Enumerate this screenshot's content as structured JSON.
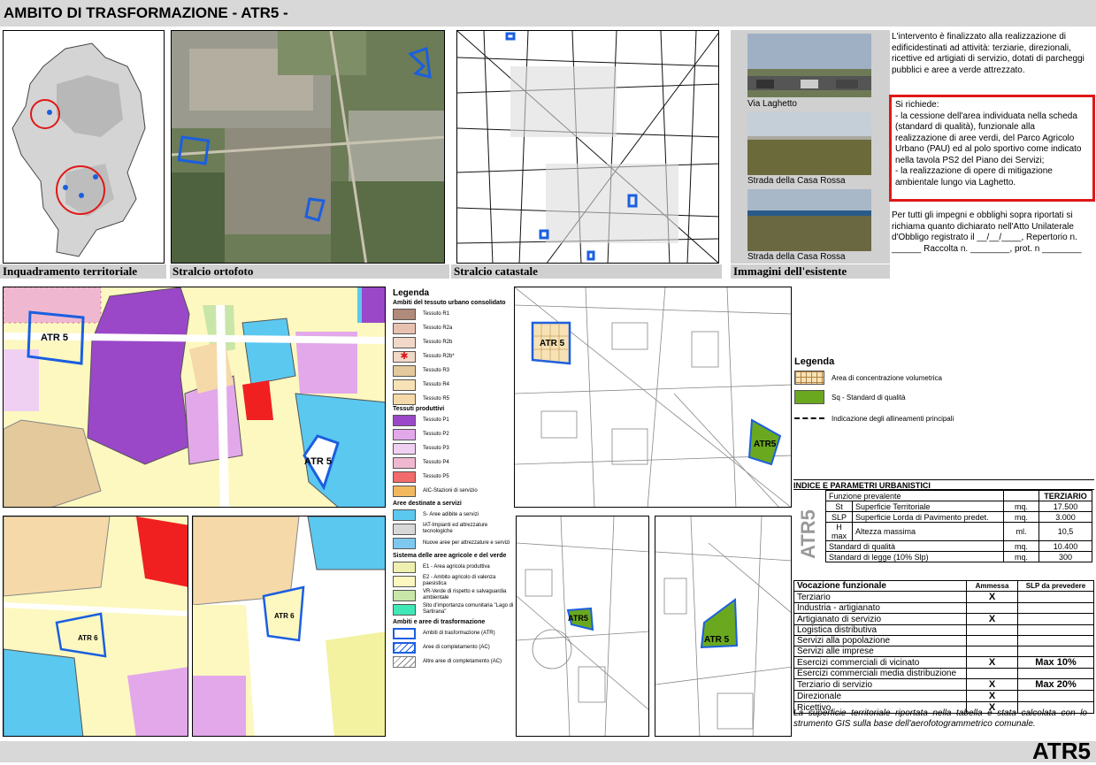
{
  "header": {
    "title": "AMBITO DI TRASFORMAZIONE - ATR5 -"
  },
  "footer": {
    "code": "ATR5"
  },
  "captions": {
    "inquadramento": "Inquadramento territoriale",
    "ortofoto": "Stralcio ortofoto",
    "catastale": "Stralcio catastale",
    "immagini": "Immagini dell'esistente"
  },
  "photos": [
    {
      "label": "Via Laghetto"
    },
    {
      "label": "Strada della Casa Rossa"
    },
    {
      "label": "Strada della Casa Rossa"
    }
  ],
  "description": {
    "intro": "L'intervento è finalizzato alla realizzazione di edificidestinati ad attività: terziarie, direzionali, ricettive ed artigiati di servizio, dotati di parcheggi pubblici e aree a verde attrezzato.",
    "richieste_title": "Si richiede:",
    "richieste_1": "- la cessione dell'area individuata nella scheda (standard di qualità), funzionale alla realizzazione di aree verdi, del Parco Agricolo Urbano (PAU) ed al polo sportivo come indicato nella tavola PS2 del Piano dei Servizi;",
    "richieste_2": "- la realizzazione di opere di mitigazione ambientale lungo via Laghetto.",
    "impegni": "Per tutti gli impegni e obblighi sopra riportati si richiama quanto dichiarato nell'Atto Unilaterale d'Obbligo registrato il __/__/____, Repertorio n. ______ Raccolta n. ________, prot. n ________"
  },
  "map_labels": {
    "atr5": "ATR 5",
    "atr6": "ATR 6",
    "atr5b": "ATR5",
    "atr5c": "ATR 5"
  },
  "legend_main": {
    "title": "Legenda",
    "group1": "Ambiti del tessuto urbano consolidato",
    "items1": [
      {
        "label": "Tessuto R1",
        "color": "#b08a7a"
      },
      {
        "label": "Tessuto R2a",
        "color": "#e8c2b0"
      },
      {
        "label": "Tessuto R2b",
        "color": "#f2d8c8"
      },
      {
        "label": "Tessuto R2b*",
        "color": "#f2d8c8"
      },
      {
        "label": "Tessuto R3",
        "color": "#e3c99c"
      },
      {
        "label": "Tessuto R4",
        "color": "#f7e2b5"
      },
      {
        "label": "Tessuto R5",
        "color": "#f5d9a8"
      }
    ],
    "group2": "Tessuti produttivi",
    "items2": [
      {
        "label": "Tessuto P1",
        "color": "#9a48c8"
      },
      {
        "label": "Tessuto P2",
        "color": "#e2a8ea"
      },
      {
        "label": "Tessuto P3",
        "color": "#f0d0f2"
      },
      {
        "label": "Tessuto P4",
        "color": "#f0b8d0"
      },
      {
        "label": "Tessuto P5",
        "color": "#f26a6a"
      },
      {
        "label": "AIC-Stazioni di servizio",
        "color": "#f2b860"
      }
    ],
    "group3": "Aree destinate a servizi",
    "items3": [
      {
        "label": "S- Aree adibite a servizi",
        "color": "#5bc8f0"
      },
      {
        "label": "IAT-Impianti ed attrezzature tecnologiche",
        "color": "#d8d8d8"
      },
      {
        "label": "Nuove aree per attrezzature e servizi",
        "color": "#7ec8f0"
      }
    ],
    "group4": "Sistema delle aree agricole e del verde",
    "items4": [
      {
        "label": "E1 - Area agricola produttiva",
        "color": "#eef0b0"
      },
      {
        "label": "E2 - Ambito agricolo di valenza paesistica",
        "color": "#fdf8c0"
      },
      {
        "label": "VR-Verde di rispetto e salvaguardia ambientale",
        "color": "#c8e6a8"
      },
      {
        "label": "Sito d'importanza comunitaria \"Lago di Sartirana\"",
        "color": "#40e8b8"
      }
    ],
    "group5": "Ambiti e aree di trasformazione",
    "items5": [
      {
        "label": "Ambiti di trasformazione (ATR)",
        "color": "#ffffff"
      },
      {
        "label": "Aree di completamento (AC)",
        "color": "#ffffff"
      },
      {
        "label": "Altre aree di completamento (AC)",
        "color": "#ffffff"
      }
    ]
  },
  "legend_right": {
    "title": "Legenda",
    "items": [
      {
        "label": "Area di concentrazione volumetrica"
      },
      {
        "label": "Sq - Standard di qualità"
      },
      {
        "label": "Indicazione degli allineamenti principali"
      }
    ]
  },
  "params": {
    "title": "INDICE E PARAMETRI URBANISTICI",
    "side": "ATR5",
    "funzione_label": "Funzione prevalente",
    "funzione_value": "TERZIARIO",
    "rows": [
      {
        "code": "St",
        "label": "Superficie Territoriale",
        "unit": "mq.",
        "value": "17.500"
      },
      {
        "code": "SLP",
        "label": "Superficie Lorda di Pavimento predet.",
        "unit": "mq.",
        "value": "3.000"
      },
      {
        "code": "H max",
        "label": "Altezza massima",
        "unit": "ml.",
        "value": "10,5"
      }
    ],
    "rows2": [
      {
        "label": "Standard di qualità",
        "unit": "mq.",
        "value": "10.400"
      },
      {
        "label": "Standard di legge (10% Slp)",
        "unit": "mq.",
        "value": "300"
      }
    ]
  },
  "vocazione": {
    "headers": [
      "Vocazione funzionale",
      "Ammessa",
      "SLP da prevedere"
    ],
    "rows": [
      {
        "label": "Terziario",
        "ammessa": "X",
        "slp": ""
      },
      {
        "label": "Industria - artigianato",
        "ammessa": "",
        "slp": ""
      },
      {
        "label": "Artigianato di servizio",
        "ammessa": "X",
        "slp": ""
      },
      {
        "label": "Logistica distributiva",
        "ammessa": "",
        "slp": ""
      },
      {
        "label": "Servizi alla popolazione",
        "ammessa": "",
        "slp": ""
      },
      {
        "label": "Servizi alle imprese",
        "ammessa": "",
        "slp": ""
      },
      {
        "label": "Esercizi commerciali di vicinato",
        "ammessa": "X",
        "slp": "Max 10%"
      },
      {
        "label": "Esercizi commerciali media distribuzione",
        "ammessa": "",
        "slp": ""
      },
      {
        "label": "Terziario di servizio",
        "ammessa": "X",
        "slp": "Max 20%"
      },
      {
        "label": "Direzionale",
        "ammessa": "X",
        "slp": ""
      },
      {
        "label": "Ricettivo",
        "ammessa": "X",
        "slp": ""
      }
    ]
  },
  "note": "La superficie territoriale riportata nella tabella è stata calcolata con lo strumento GIS sulla base dell'aerofotogrammetrico comunale."
}
